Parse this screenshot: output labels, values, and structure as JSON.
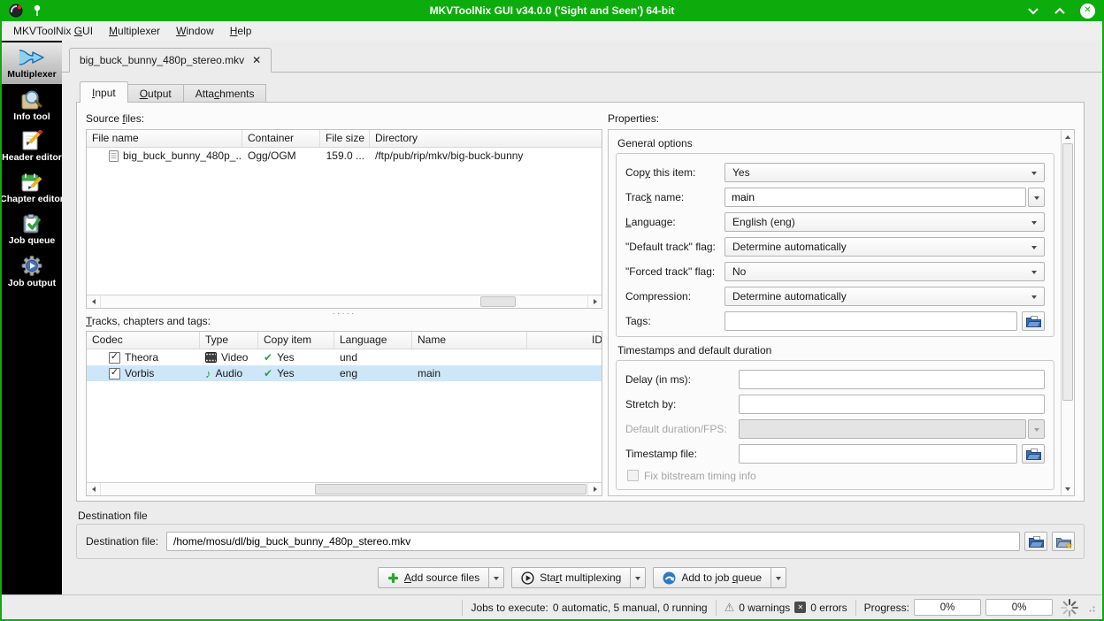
{
  "window": {
    "title": "MKVToolNix GUI v34.0.0 ('Sight and Seen') 64-bit"
  },
  "colors": {
    "titlebar_green": "#0cac0c",
    "selection_blue": "#cde7f8"
  },
  "glyphs": {
    "window_close": "✕",
    "tab_close": "✕",
    "checkbox_check": "✓",
    "copy_check": "✔",
    "audio_note": "♪",
    "warning": "⚠",
    "error_x": "✕",
    "splitter_dots": "·····",
    "folder_star": "★"
  },
  "menubar": {
    "items": [
      {
        "pre": "MKVToolNix ",
        "key": "G",
        "post": "UI"
      },
      {
        "pre": "",
        "key": "M",
        "post": "ultiplexer"
      },
      {
        "pre": "",
        "key": "W",
        "post": "indow"
      },
      {
        "pre": "",
        "key": "H",
        "post": "elp"
      }
    ]
  },
  "sidebar": {
    "items": [
      {
        "icon": "multiplexer-icon",
        "label": "Multiplexer",
        "active": true
      },
      {
        "icon": "info-tool-icon",
        "label": "Info tool",
        "active": false
      },
      {
        "icon": "header-editor-icon",
        "label": "Header editor",
        "active": false
      },
      {
        "icon": "chapter-editor-icon",
        "label": "Chapter editor",
        "active": false
      },
      {
        "icon": "job-queue-icon",
        "label": "Job queue",
        "active": false
      },
      {
        "icon": "job-output-icon",
        "label": "Job output",
        "active": false
      }
    ]
  },
  "file_tab": {
    "label": "big_buck_bunny_480p_stereo.mkv"
  },
  "inner_tabs": {
    "input": {
      "pre": "",
      "key": "I",
      "post": "nput",
      "active": true
    },
    "output": {
      "pre": "",
      "key": "O",
      "post": "utput",
      "active": false
    },
    "attachments": {
      "pre": "Atta",
      "key": "c",
      "post": "hments",
      "active": false
    }
  },
  "source_files": {
    "label": {
      "pre": "Source ",
      "key": "f",
      "post": "iles:"
    },
    "headers": {
      "file_name": "File name",
      "container": "Container",
      "file_size": "File size",
      "directory": "Directory"
    },
    "rows": [
      {
        "file_name": "big_buck_bunny_480p_...",
        "container": "Ogg/OGM",
        "file_size": "159.0 ...",
        "directory": "/ftp/pub/rip/mkv/big-buck-bunny"
      }
    ]
  },
  "tracks": {
    "label": {
      "pre": "",
      "key": "T",
      "post": "racks, chapters and tags:"
    },
    "headers": {
      "codec": "Codec",
      "type": "Type",
      "copy_item": "Copy item",
      "language": "Language",
      "name": "Name",
      "id": "ID"
    },
    "rows": [
      {
        "enabled": true,
        "codec": "Theora",
        "type": "Video",
        "copy_item": "Yes",
        "language": "und",
        "name": "",
        "selected": false
      },
      {
        "enabled": true,
        "codec": "Vorbis",
        "type": "Audio",
        "copy_item": "Yes",
        "language": "eng",
        "name": "main",
        "selected": true
      }
    ]
  },
  "properties": {
    "label": "Properties:",
    "general": {
      "title": "General options",
      "copy_this_item": {
        "label": {
          "pre": "Cop",
          "key": "y",
          "post": " this item:"
        },
        "value": "Yes"
      },
      "track_name": {
        "label": {
          "pre": "Trac",
          "key": "k",
          "post": " name:"
        },
        "value": "main"
      },
      "language": {
        "label": {
          "pre": "",
          "key": "L",
          "post": "anguage:"
        },
        "value": "English (eng)"
      },
      "default_track_flag": {
        "label": "\"Default track\" flag:",
        "value": "Determine automatically"
      },
      "forced_track_flag": {
        "label": "\"Forced track\" flag:",
        "value": "No"
      },
      "compression": {
        "label": "Compression:",
        "value": "Determine automatically"
      },
      "tags": {
        "label": "Tags:",
        "value": ""
      }
    },
    "timestamps": {
      "title": "Timestamps and default duration",
      "delay": {
        "label": "Delay (in ms):",
        "value": ""
      },
      "stretch_by": {
        "label": "Stretch by:",
        "value": ""
      },
      "default_duration": {
        "label": "Default duration/FPS:",
        "value": "",
        "disabled": true
      },
      "timestamp_file": {
        "label": "Timestamp file:",
        "value": ""
      },
      "fix_bitstream": {
        "label": "Fix bitstream timing info",
        "disabled": true,
        "checked": false
      }
    }
  },
  "destination": {
    "group_title": "Destination file",
    "label": "Destination file:",
    "value": "/home/mosu/dl/big_buck_bunny_480p_stereo.mkv"
  },
  "actions": {
    "add_source_files": {
      "pre": "",
      "key": "A",
      "post": "dd source files"
    },
    "start_multiplexing": {
      "pre": "Sta",
      "key": "r",
      "post": "t multiplexing"
    },
    "add_to_job_queue": {
      "pre": "Add to job ",
      "key": "q",
      "post": "ueue"
    }
  },
  "statusbar": {
    "jobs_label": "Jobs to execute:",
    "jobs_value": "0 automatic, 5 manual, 0 running",
    "warnings": "0 warnings",
    "errors": "0 errors",
    "progress_label": "Progress:",
    "progress1": "0%",
    "progress2": "0%"
  }
}
